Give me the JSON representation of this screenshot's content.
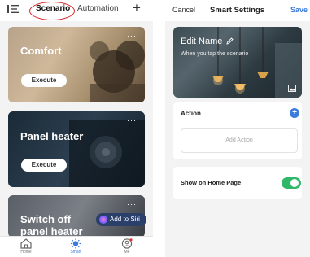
{
  "left": {
    "header": {
      "tab_scenario": "Scenario",
      "tab_automation": "Automation",
      "add": "+"
    },
    "cards": [
      {
        "title": "Comfort",
        "more": "···",
        "execute": "Execute"
      },
      {
        "title": "Panel heater",
        "more": "···",
        "execute": "Execute"
      },
      {
        "title": "Switch off panel heater",
        "more": "···",
        "siri": "Add to Siri"
      }
    ],
    "tabbar": {
      "home": "Home",
      "smart": "Smart",
      "me": "Me"
    }
  },
  "right": {
    "header": {
      "cancel": "Cancel",
      "title": "Smart Settings",
      "save": "Save"
    },
    "hero": {
      "name": "Edit Name",
      "subtitle": "When you tap the  scenario"
    },
    "action": {
      "label": "Action",
      "add_action": "Add Action",
      "add_symbol": "+"
    },
    "show_home": {
      "label": "Show on Home Page",
      "enabled": true
    }
  },
  "colors": {
    "accent": "#3a7bdc",
    "toggle_on": "#2fb868",
    "highlight_circle": "#d8262c"
  },
  "icons": [
    "list-icon",
    "plus-icon",
    "more-icon",
    "siri-icon",
    "home-icon",
    "smart-icon",
    "me-icon",
    "pencil-icon",
    "image-icon",
    "add-icon"
  ]
}
